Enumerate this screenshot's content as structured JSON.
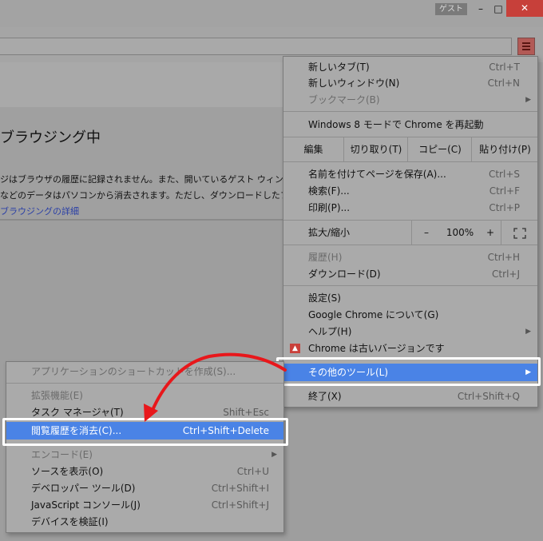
{
  "window": {
    "guest_label": "ゲスト",
    "minimize": "–",
    "maximize": "□",
    "close": "✕"
  },
  "page": {
    "heading": "ブラウジング中",
    "para1": "ジはブラウザの履歴に記録されません。また、開いているゲスト ウィン",
    "para2": "などのデータはパソコンから消去されます。ただし、ダウンロードしたフ",
    "link": "ブラウジングの詳細"
  },
  "menu": {
    "new_tab": {
      "label": "新しいタブ(T)",
      "shortcut": "Ctrl+T"
    },
    "new_window": {
      "label": "新しいウィンドウ(N)",
      "shortcut": "Ctrl+N"
    },
    "bookmarks": {
      "label": "ブックマーク(B)"
    },
    "relaunch": {
      "label": "Windows 8 モードで Chrome を再起動"
    },
    "edit": {
      "label": "編集",
      "cut": "切り取り(T)",
      "copy": "コピー(C)",
      "paste": "貼り付け(P)"
    },
    "save_as": {
      "label": "名前を付けてページを保存(A)...",
      "shortcut": "Ctrl+S"
    },
    "find": {
      "label": "検索(F)...",
      "shortcut": "Ctrl+F"
    },
    "print": {
      "label": "印刷(P)...",
      "shortcut": "Ctrl+P"
    },
    "zoom": {
      "label": "拡大/縮小",
      "minus": "–",
      "value": "100%",
      "plus": "+"
    },
    "history": {
      "label": "履歴(H)",
      "shortcut": "Ctrl+H"
    },
    "downloads": {
      "label": "ダウンロード(D)",
      "shortcut": "Ctrl+J"
    },
    "settings": {
      "label": "設定(S)"
    },
    "about": {
      "label": "Google Chrome について(G)"
    },
    "help": {
      "label": "ヘルプ(H)"
    },
    "update": {
      "label": "Chrome は古いバージョンです"
    },
    "more_tools": {
      "label": "その他のツール(L)"
    },
    "exit": {
      "label": "終了(X)",
      "shortcut": "Ctrl+Shift+Q"
    }
  },
  "submenu": {
    "app_shortcut": {
      "label": "アプリケーションのショートカットを作成(S)..."
    },
    "extensions": {
      "label": "拡張機能(E)"
    },
    "task_manager": {
      "label": "タスク マネージャ(T)",
      "shortcut": "Shift+Esc"
    },
    "clear_data": {
      "label": "閲覧履歴を消去(C)...",
      "shortcut": "Ctrl+Shift+Delete"
    },
    "encoding": {
      "label": "エンコード(E)"
    },
    "view_source": {
      "label": "ソースを表示(O)",
      "shortcut": "Ctrl+U"
    },
    "dev_tools": {
      "label": "デベロッパー ツール(D)",
      "shortcut": "Ctrl+Shift+I"
    },
    "js_console": {
      "label": "JavaScript コンソール(J)",
      "shortcut": "Ctrl+Shift+J"
    },
    "inspect_devices": {
      "label": "デバイスを検証(I)"
    }
  },
  "colors": {
    "highlight": "#4a83e6",
    "annotation_arrow": "#e8171b",
    "close_button": "#c7403a"
  }
}
